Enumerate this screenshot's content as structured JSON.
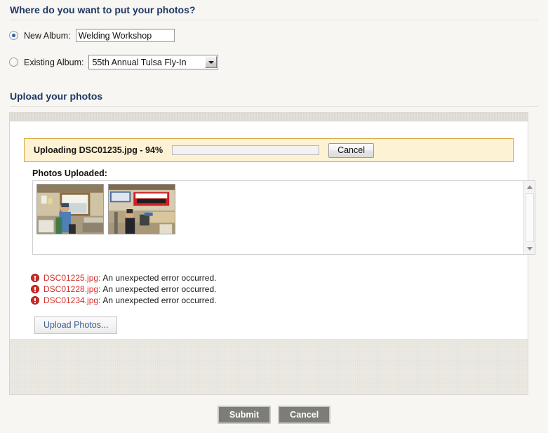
{
  "sections": {
    "album": {
      "heading": "Where do you want to put your photos?"
    },
    "upload": {
      "heading": "Upload your photos"
    }
  },
  "album_form": {
    "new_album": {
      "label": "New Album:",
      "selected": true,
      "value": "Welding Workshop",
      "placeholder": ""
    },
    "existing_album": {
      "label": "Existing Album:",
      "selected": false,
      "value": "55th Annual Tulsa Fly-In",
      "options": [
        "55th Annual Tulsa Fly-In"
      ]
    }
  },
  "uploader": {
    "status_text": "Uploading DSC01235.jpg - 94%",
    "current_file": "DSC01235.jpg",
    "progress_percent": 94,
    "cancel_label": "Cancel",
    "photos_uploaded_label": "Photos Uploaded:",
    "thumbnails": [
      {
        "alt": "Man in blue shirt standing in workshop by a bright window"
      },
      {
        "alt": "Workshop with red LINCOLN ELECTRIC banner and person below it"
      }
    ],
    "errors": [
      {
        "file": "DSC01225.jpg:",
        "message": "An unexpected error occurred."
      },
      {
        "file": "DSC01228.jpg:",
        "message": "An unexpected error occurred."
      },
      {
        "file": "DSC01234.jpg:",
        "message": "An unexpected error occurred."
      }
    ],
    "upload_button_label": "Upload Photos..."
  },
  "actions": {
    "submit_label": "Submit",
    "cancel_label": "Cancel"
  },
  "colors": {
    "heading": "#1f3864",
    "progress": "#1a9ad4",
    "banner_bg": "#fdf2d4",
    "banner_border": "#d2a93f",
    "error_text": "#d4312c",
    "action_button": "#7c7c78",
    "link_text": "#3d5a96"
  }
}
